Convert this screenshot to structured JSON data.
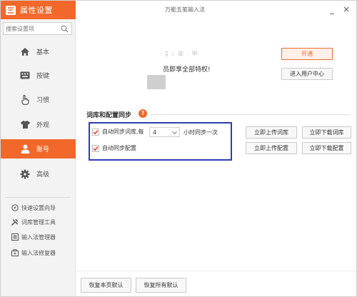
{
  "app": {
    "title": "属性设置",
    "window_title": "万能五笔输入法",
    "minimize_symbol": "_",
    "close_symbol": "×",
    "accent_color": "#f2682a"
  },
  "search": {
    "placeholder": "搜索设置项",
    "icon": "search-icon"
  },
  "nav": [
    {
      "label": "基本",
      "icon": "home-icon",
      "active": false
    },
    {
      "label": "按键",
      "icon": "keyboard-icon",
      "active": false
    },
    {
      "label": "习惯",
      "icon": "hand-icon",
      "active": false
    },
    {
      "label": "外观",
      "icon": "shirt-icon",
      "active": false
    },
    {
      "label": "账号",
      "icon": "user-icon",
      "active": true
    },
    {
      "label": "高级",
      "icon": "gear-icon",
      "active": false
    }
  ],
  "tools": [
    {
      "label": "快速设置向导",
      "icon": "compass-icon"
    },
    {
      "label": "词库管理工具",
      "icon": "tools-icon"
    },
    {
      "label": "输入法管理器",
      "icon": "list-icon"
    },
    {
      "label": "输入法修复器",
      "icon": "repair-icon"
    }
  ],
  "account": {
    "username": "訁冫卿 · 甲",
    "promo": "员即享全部特权!",
    "open_vip_label": "开通",
    "user_center_label": "进入用户中心"
  },
  "sync": {
    "section_title": "词库和配置同步",
    "help_symbol": "?",
    "auto_sync_dict_label": "自动同步词库,每",
    "auto_sync_dict_checked": true,
    "interval_value": "4",
    "interval_unit": "小时同步一次",
    "auto_sync_config_label": "自动同步配置",
    "auto_sync_config_checked": true,
    "upload_dict_label": "立即上传词库",
    "download_dict_label": "立即下载词库",
    "upload_config_label": "立即上传配置",
    "download_config_label": "立即下载配置"
  },
  "footer": {
    "restore_page_label": "恢复本页默认",
    "restore_all_label": "恢复所有默认"
  }
}
